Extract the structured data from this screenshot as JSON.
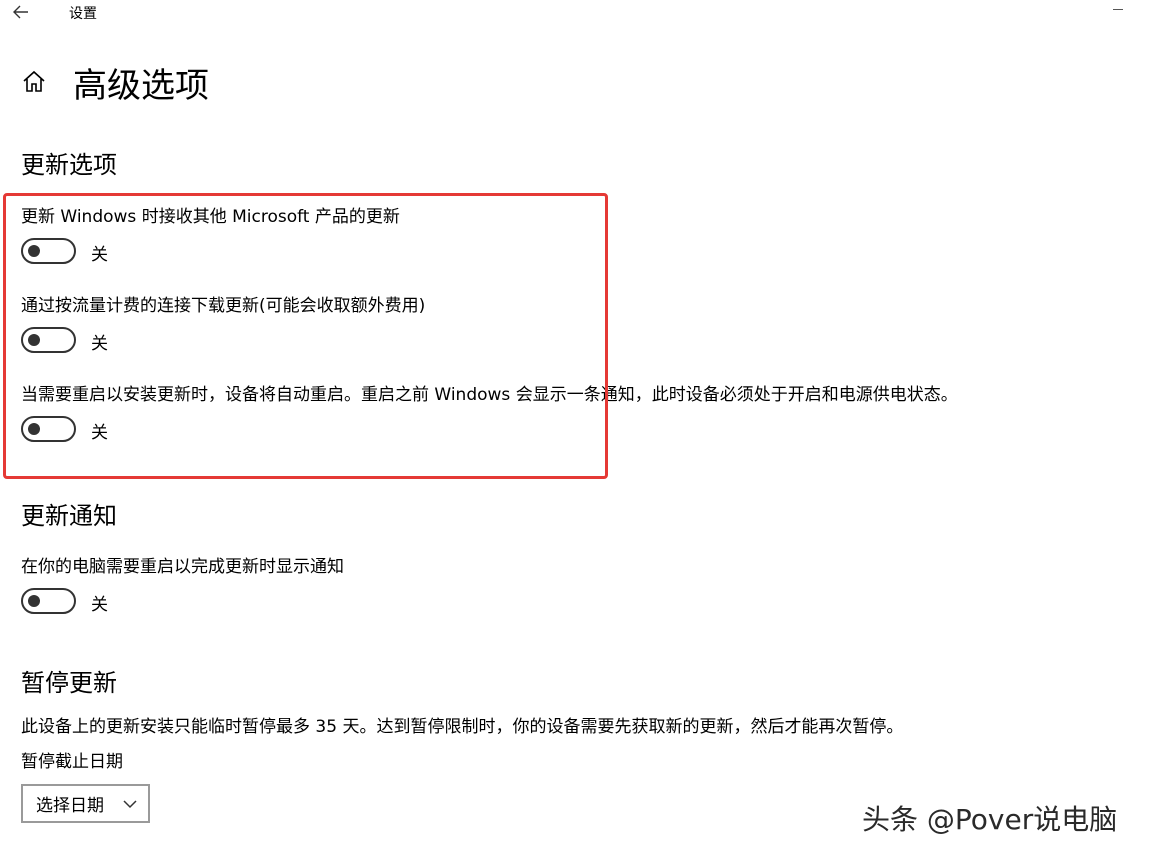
{
  "window": {
    "title": "设置"
  },
  "page": {
    "title": "高级选项"
  },
  "update_options": {
    "heading": "更新选项",
    "items": [
      {
        "label": "更新 Windows 时接收其他 Microsoft 产品的更新",
        "state": "关"
      },
      {
        "label": "通过按流量计费的连接下载更新(可能会收取额外费用)",
        "state": "关"
      },
      {
        "label": "当需要重启以安装更新时，设备将自动重启。重启之前 Windows 会显示一条通知，此时设备必须处于开启和电源供电状态。",
        "state": "关"
      }
    ]
  },
  "update_notifications": {
    "heading": "更新通知",
    "items": [
      {
        "label": "在你的电脑需要重启以完成更新时显示通知",
        "state": "关"
      }
    ]
  },
  "pause_updates": {
    "heading": "暂停更新",
    "description": "此设备上的更新安装只能临时暂停最多 35 天。达到暂停限制时，你的设备需要先获取新的更新，然后才能再次暂停。",
    "date_label": "暂停截止日期",
    "date_select_value": "选择日期"
  },
  "watermark": "头条 @Pover说电脑",
  "colors": {
    "highlight": "#e53935"
  }
}
